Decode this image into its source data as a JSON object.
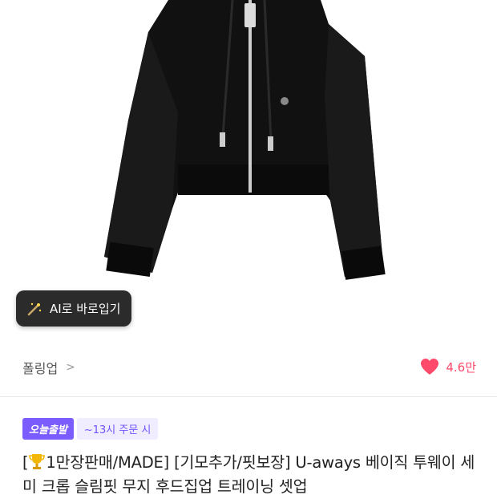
{
  "product_image": {
    "alt_icon": "black-cropped-zip-hoodie"
  },
  "ai_button": {
    "label": "AI로 바로입기",
    "icon": "magic-wand-icon"
  },
  "brand": {
    "name": "폴링업",
    "chevron": ">"
  },
  "likes": {
    "count": "4.6만",
    "icon": "heart-icon",
    "color": "#ff4a6b"
  },
  "badges": {
    "today_ship": "오늘출발",
    "order_deadline": "~13시 주문 시"
  },
  "product": {
    "title_prefix": "[",
    "title_rest": "1만장판매/MADE] [기모추가/핏보장] U-aways 베이직 투웨이 세미 크롭 슬림핏 무지 후드집업 트레이닝 셋업"
  },
  "colors": {
    "accent": "#7a5cff",
    "accent_light": "#efedff",
    "heart": "#ff4a6b"
  }
}
